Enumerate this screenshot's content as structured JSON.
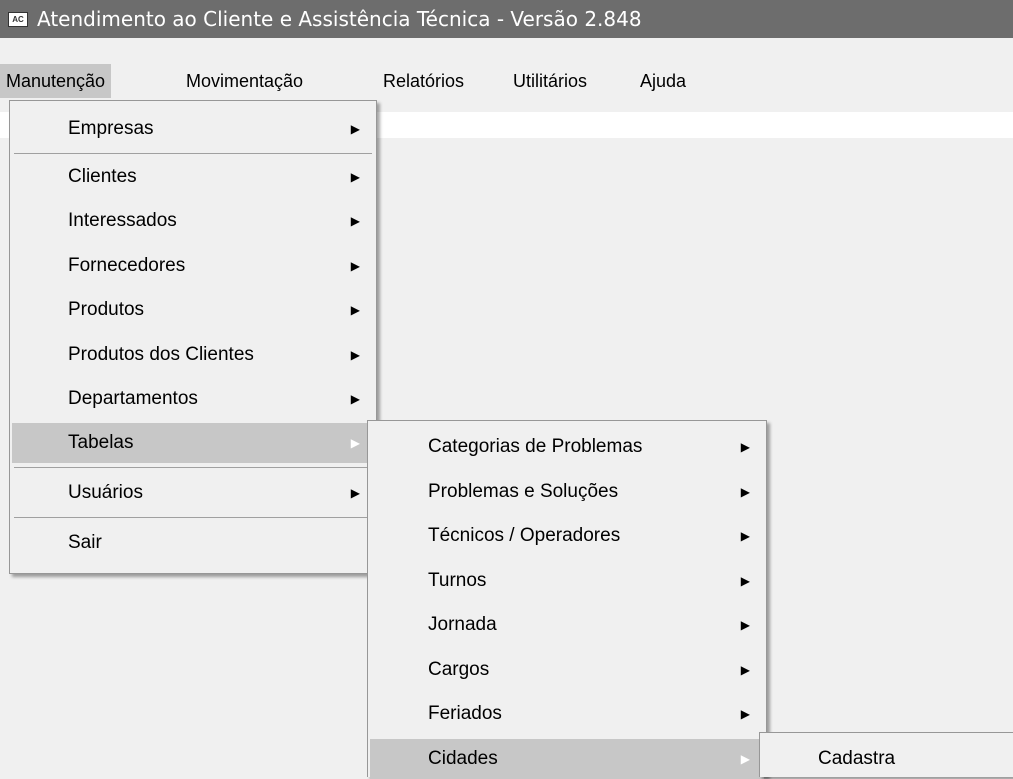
{
  "window": {
    "icon_text": "AC",
    "title": "Atendimento ao Cliente e Assistência Técnica - Versão 2.848"
  },
  "menubar": {
    "items": [
      "Manutenção",
      "Movimentação",
      "Relatórios",
      "Utilitários",
      "Ajuda"
    ],
    "active": "Manutenção"
  },
  "manutencao_menu": {
    "items": [
      {
        "label": "Empresas",
        "submenu": true
      },
      {
        "label": "Clientes",
        "submenu": true
      },
      {
        "label": "Interessados",
        "submenu": true
      },
      {
        "label": "Fornecedores",
        "submenu": true
      },
      {
        "label": "Produtos",
        "submenu": true
      },
      {
        "label": "Produtos dos Clientes",
        "submenu": true
      },
      {
        "label": "Departamentos",
        "submenu": true
      },
      {
        "label": "Tabelas",
        "submenu": true,
        "highlighted": true
      },
      {
        "label": "Usuários",
        "submenu": true
      },
      {
        "label": "Sair",
        "submenu": false
      }
    ]
  },
  "tabelas_menu": {
    "items": [
      {
        "label": "Categorias de Problemas",
        "submenu": true
      },
      {
        "label": "Problemas e Soluções",
        "submenu": true
      },
      {
        "label": "Técnicos / Operadores",
        "submenu": true
      },
      {
        "label": "Turnos",
        "submenu": true
      },
      {
        "label": "Jornada",
        "submenu": true
      },
      {
        "label": "Cargos",
        "submenu": true
      },
      {
        "label": "Feriados",
        "submenu": true
      },
      {
        "label": "Cidades",
        "submenu": true,
        "highlighted": true
      }
    ]
  },
  "cidades_menu": {
    "items": [
      {
        "label": "Cadastra"
      }
    ]
  },
  "icons": {
    "submenu_arrow": "right-triangle-icon"
  }
}
